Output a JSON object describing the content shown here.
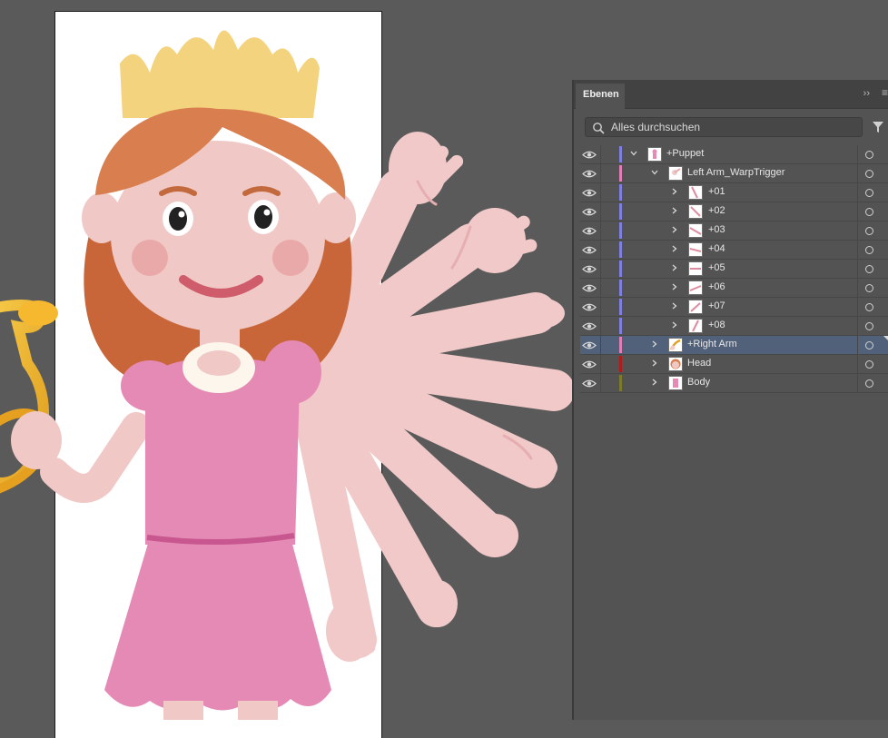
{
  "panel": {
    "tab_label": "Ebenen",
    "collapse_glyph": "››",
    "menu_glyph": "≡",
    "search_placeholder": "Alles durchsuchen"
  },
  "icons": {
    "visibility": "eye-icon",
    "search": "search-icon",
    "filter": "filter-icon",
    "expand": "chevron-right-icon",
    "expanded": "chevron-down-icon",
    "target": "circle-target-icon"
  },
  "colors": {
    "selection": "#51617a",
    "panel_bg": "#535353",
    "pasteboard": "#5a5a5a"
  },
  "layers": [
    {
      "name": "+Puppet",
      "bar_color": "#7f7fe0"
    },
    {
      "name": "Left Arm_WarpTrigger",
      "bar_color": "#e07fb5"
    },
    {
      "name": "+01",
      "bar_color": "#7f7fe0"
    },
    {
      "name": "+02",
      "bar_color": "#7f7fe0"
    },
    {
      "name": "+03",
      "bar_color": "#7f7fe0"
    },
    {
      "name": "+04",
      "bar_color": "#7f7fe0"
    },
    {
      "name": "+05",
      "bar_color": "#7f7fe0"
    },
    {
      "name": "+06",
      "bar_color": "#7f7fe0"
    },
    {
      "name": "+07",
      "bar_color": "#7f7fe0"
    },
    {
      "name": "+08",
      "bar_color": "#7f7fe0"
    },
    {
      "name": "+Right Arm",
      "bar_color": "#e07fb5"
    },
    {
      "name": "Head",
      "bar_color": "#b01c1c"
    },
    {
      "name": "Body",
      "bar_color": "#7b7b2a"
    }
  ]
}
